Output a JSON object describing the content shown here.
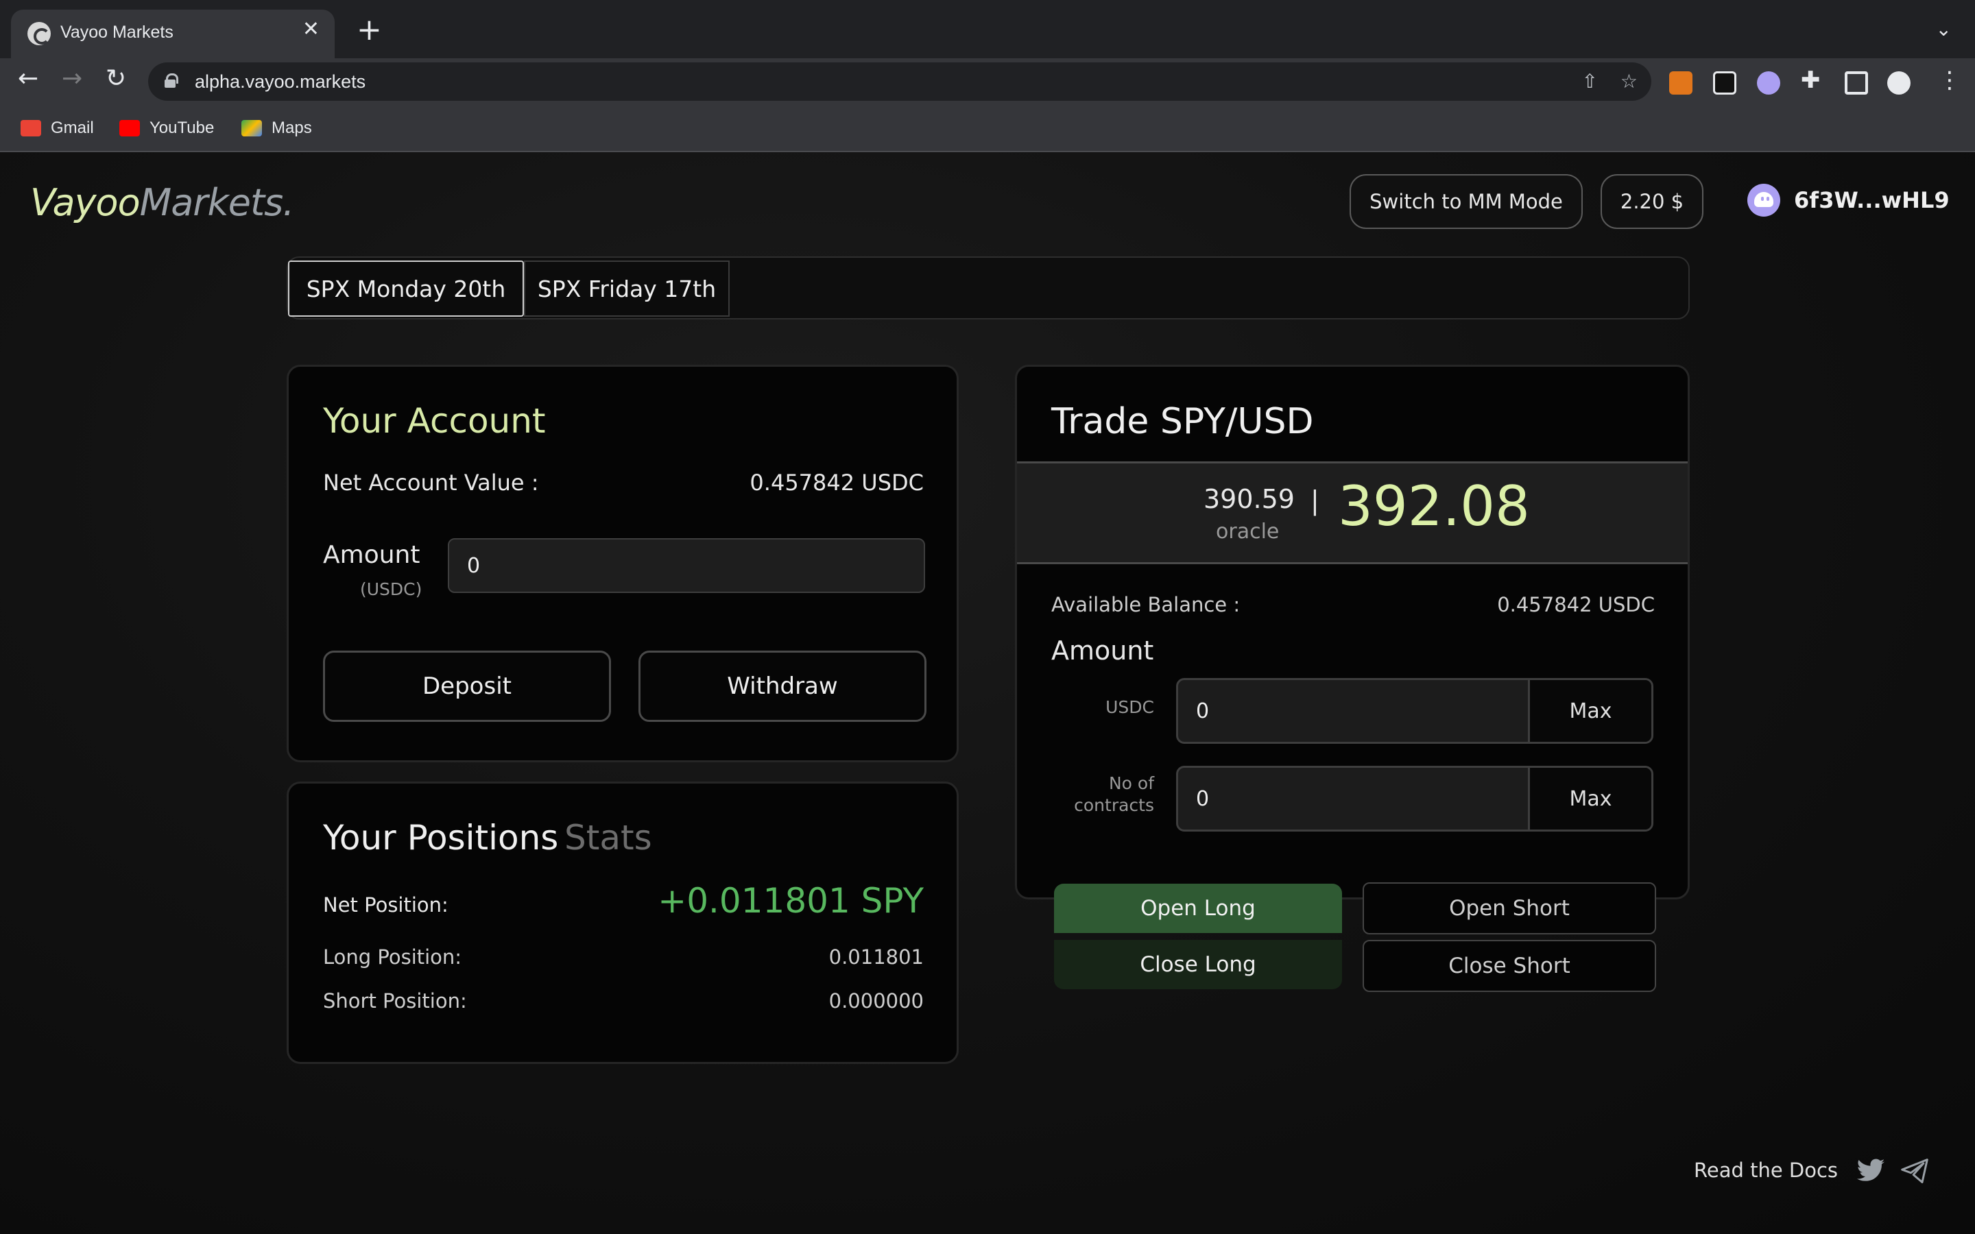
{
  "browser": {
    "tab_title": "Vayoo Markets",
    "url": "alpha.vayoo.markets",
    "bookmarks": [
      {
        "label": "Gmail",
        "icon": "gmail-icon"
      },
      {
        "label": "YouTube",
        "icon": "youtube-icon"
      },
      {
        "label": "Maps",
        "icon": "maps-icon"
      }
    ]
  },
  "header": {
    "logo_a": "Vayoo",
    "logo_b": "Markets.",
    "mm_mode_label": "Switch to MM Mode",
    "sol_price": "2.20 $",
    "wallet_address": "6f3W...wHL9"
  },
  "market_tabs": [
    {
      "label": "SPX Monday 20th",
      "active": true
    },
    {
      "label": "SPX Friday 17th",
      "active": false
    }
  ],
  "account": {
    "title": "Your Account",
    "net_value_label": "Net Account Value :",
    "net_value": "0.457842 USDC",
    "amount_label": "Amount",
    "amount_unit": "(USDC)",
    "amount_value": "0",
    "deposit_label": "Deposit",
    "withdraw_label": "Withdraw"
  },
  "positions": {
    "title": "Your Positions",
    "stats_label": "Stats",
    "net_label": "Net Position:",
    "net_value": "+0.011801 SPY",
    "long_label": "Long Position:",
    "long_value": "0.011801",
    "short_label": "Short Position:",
    "short_value": "0.000000"
  },
  "trade": {
    "title": "Trade SPY/USD",
    "oracle_price": "390.59",
    "oracle_label": "oracle",
    "separator": "|",
    "mark_price": "392.08",
    "available_label": "Available Balance :",
    "available_value": "0.457842 USDC",
    "amount_label": "Amount",
    "usdc_label": "USDC",
    "usdc_value": "0",
    "contracts_label_1": "No of",
    "contracts_label_2": "contracts",
    "contracts_value": "0",
    "max_label": "Max",
    "open_long": "Open Long",
    "close_long": "Close Long",
    "open_short": "Open Short",
    "close_short": "Close Short"
  },
  "footer": {
    "docs_label": "Read the Docs"
  },
  "colors": {
    "accent_green": "#58b85f",
    "logo_green": "#dcebb0",
    "open_long_bg": "#2f5a33",
    "close_long_bg": "#172517"
  }
}
